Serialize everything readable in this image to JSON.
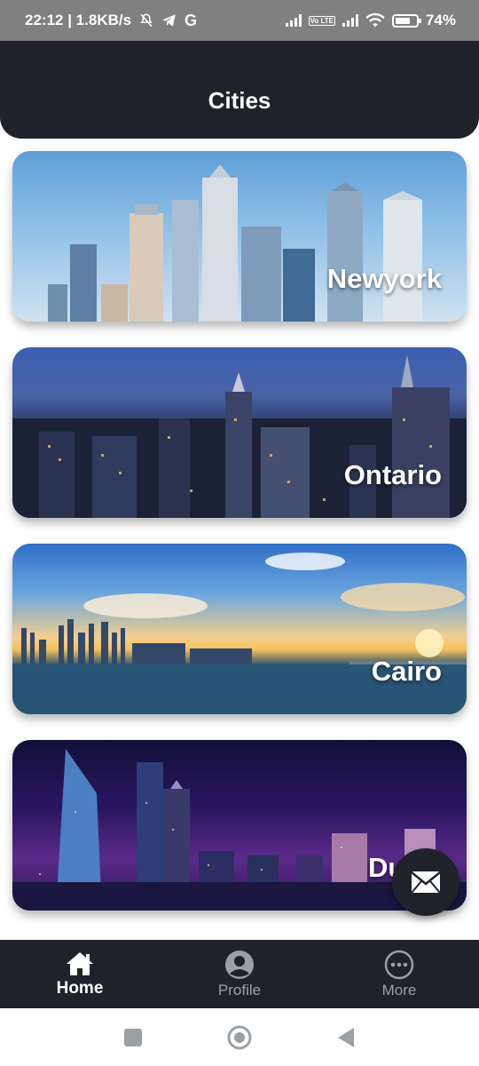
{
  "status_bar": {
    "time_speed": "22:12 | 1.8KB/s",
    "icons": [
      "mute-bell-icon",
      "telegram-icon",
      "google-icon",
      "signal-icon",
      "volte-icon",
      "signal-icon",
      "wifi-icon",
      "battery-icon"
    ],
    "volte_label": "Vo LTE",
    "battery_percent": "74%",
    "battery_level": 0.74
  },
  "app_bar": {
    "title": "Cities"
  },
  "cities": [
    {
      "name": "Newyork"
    },
    {
      "name": "Ontario"
    },
    {
      "name": "Cairo"
    },
    {
      "name": "Du"
    }
  ],
  "fab": {
    "icon": "mail-icon"
  },
  "bottom_nav": {
    "items": [
      {
        "label": "Home",
        "icon": "home-icon",
        "active": true
      },
      {
        "label": "Profile",
        "icon": "account-circle-icon",
        "active": false
      },
      {
        "label": "More",
        "icon": "more-horizontal-icon",
        "active": false
      }
    ]
  },
  "system_nav": {
    "icons": [
      "recents-square-icon",
      "home-circle-icon",
      "back-triangle-icon"
    ]
  },
  "colors": {
    "app_bar": "#1f2229",
    "status_bar": "#808080",
    "nav_inactive": "#9aa0a6"
  }
}
